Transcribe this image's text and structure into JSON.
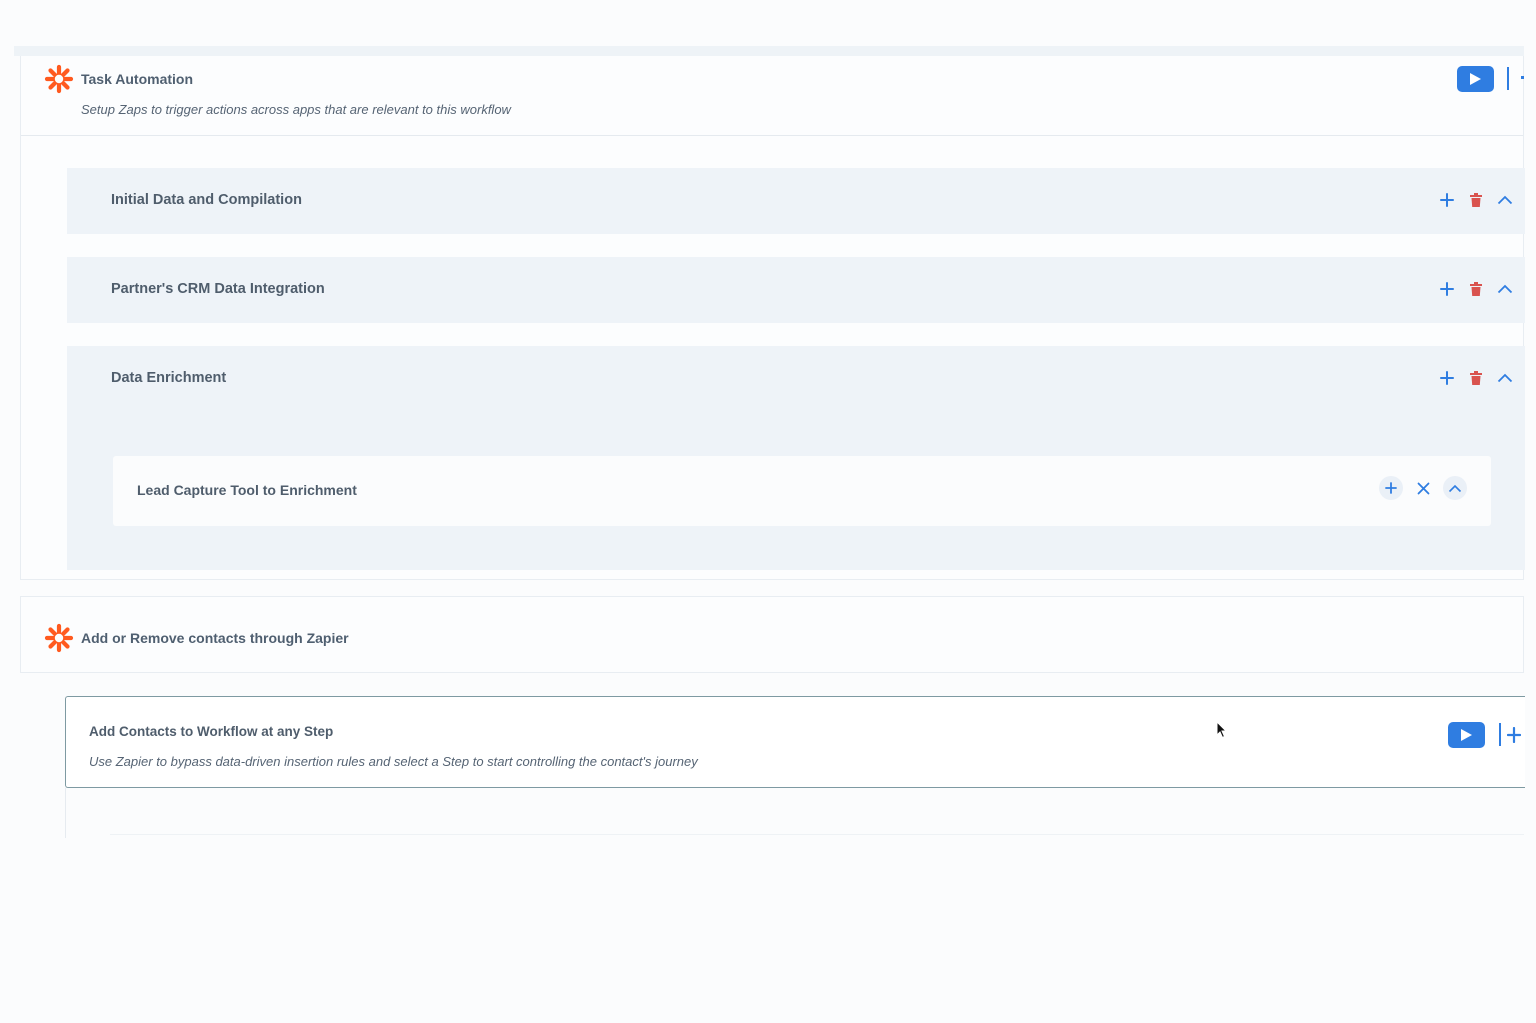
{
  "colors": {
    "accent_blue": "#2f7de1",
    "danger_red": "#d9534f",
    "zapier_orange": "#ff5a1f"
  },
  "task_section": {
    "icon": "zapier-asterisk-icon",
    "title": "Task Automation",
    "subtitle": "Setup Zaps to trigger actions across apps that are relevant to this workflow",
    "video_icon": "play-icon"
  },
  "groups": [
    {
      "title": "Initial Data and Compilation",
      "expanded": false
    },
    {
      "title": "Partner's CRM Data Integration",
      "expanded": false
    },
    {
      "title": "Data Enrichment",
      "expanded": true
    }
  ],
  "enrichment_item": {
    "title": "Lead Capture Tool to Enrichment"
  },
  "contacts_section": {
    "icon": "zapier-asterisk-icon",
    "title": "Add or Remove contacts through Zapier"
  },
  "trigger_card": {
    "title": "Add Contacts to Workflow at any Step",
    "description": "Use Zapier to bypass data-driven insertion rules and select a Step to start controlling the contact's journey",
    "video_icon": "play-icon"
  }
}
